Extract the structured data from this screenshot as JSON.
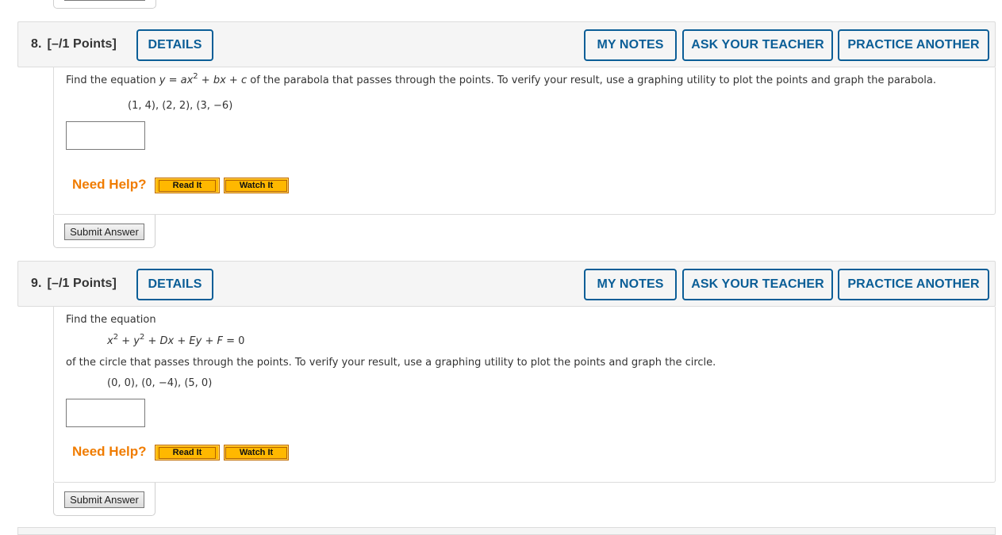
{
  "questions": [
    {
      "number": "8.",
      "points": "[–/1 Points]",
      "details_label": "DETAILS",
      "my_notes_label": "MY NOTES",
      "ask_teacher_label": "ASK YOUR TEACHER",
      "practice_label": "PRACTICE ANOTHER",
      "text_before": "Find the equation ",
      "equation": {
        "y": "y",
        "eq": " = ",
        "a": "a",
        "x": "x",
        "exp": "2",
        "plus1": " + ",
        "b": "b",
        "x2": "x",
        "plus2": " + ",
        "c": "c"
      },
      "text_after": " of the parabola that passes through the points. To verify your result, use a graphing utility to plot the points and graph the parabola.",
      "points_list": "(1, 4), (2, 2), (3, −6)",
      "answer_value": "",
      "need_help_label": "Need Help?",
      "read_it_label": "Read It",
      "watch_it_label": "Watch It",
      "submit_label": "Submit Answer"
    },
    {
      "number": "9.",
      "points": "[–/1 Points]",
      "details_label": "DETAILS",
      "my_notes_label": "MY NOTES",
      "ask_teacher_label": "ASK YOUR TEACHER",
      "practice_label": "PRACTICE ANOTHER",
      "intro": "Find the equation",
      "equation": {
        "x": "x",
        "exp1": "2",
        "p1": " + ",
        "y": "y",
        "exp2": "2",
        "p2": " + ",
        "D": "D",
        "x2": "x",
        "p3": " + ",
        "E": "E",
        "y2": "y",
        "p4": " + ",
        "F": "F",
        "rest": " = 0"
      },
      "text_after": "of the circle that passes through the points. To verify your result, use a graphing utility to plot the points and graph the circle.",
      "points_list": "(0, 0), (0, −4), (5, 0)",
      "answer_value": "",
      "need_help_label": "Need Help?",
      "read_it_label": "Read It",
      "watch_it_label": "Watch It",
      "submit_label": "Submit Answer"
    }
  ],
  "colors": {
    "accent_blue": "#0b5e97",
    "help_orange": "#f07c00",
    "help_button_yellow": "#ffb800"
  }
}
